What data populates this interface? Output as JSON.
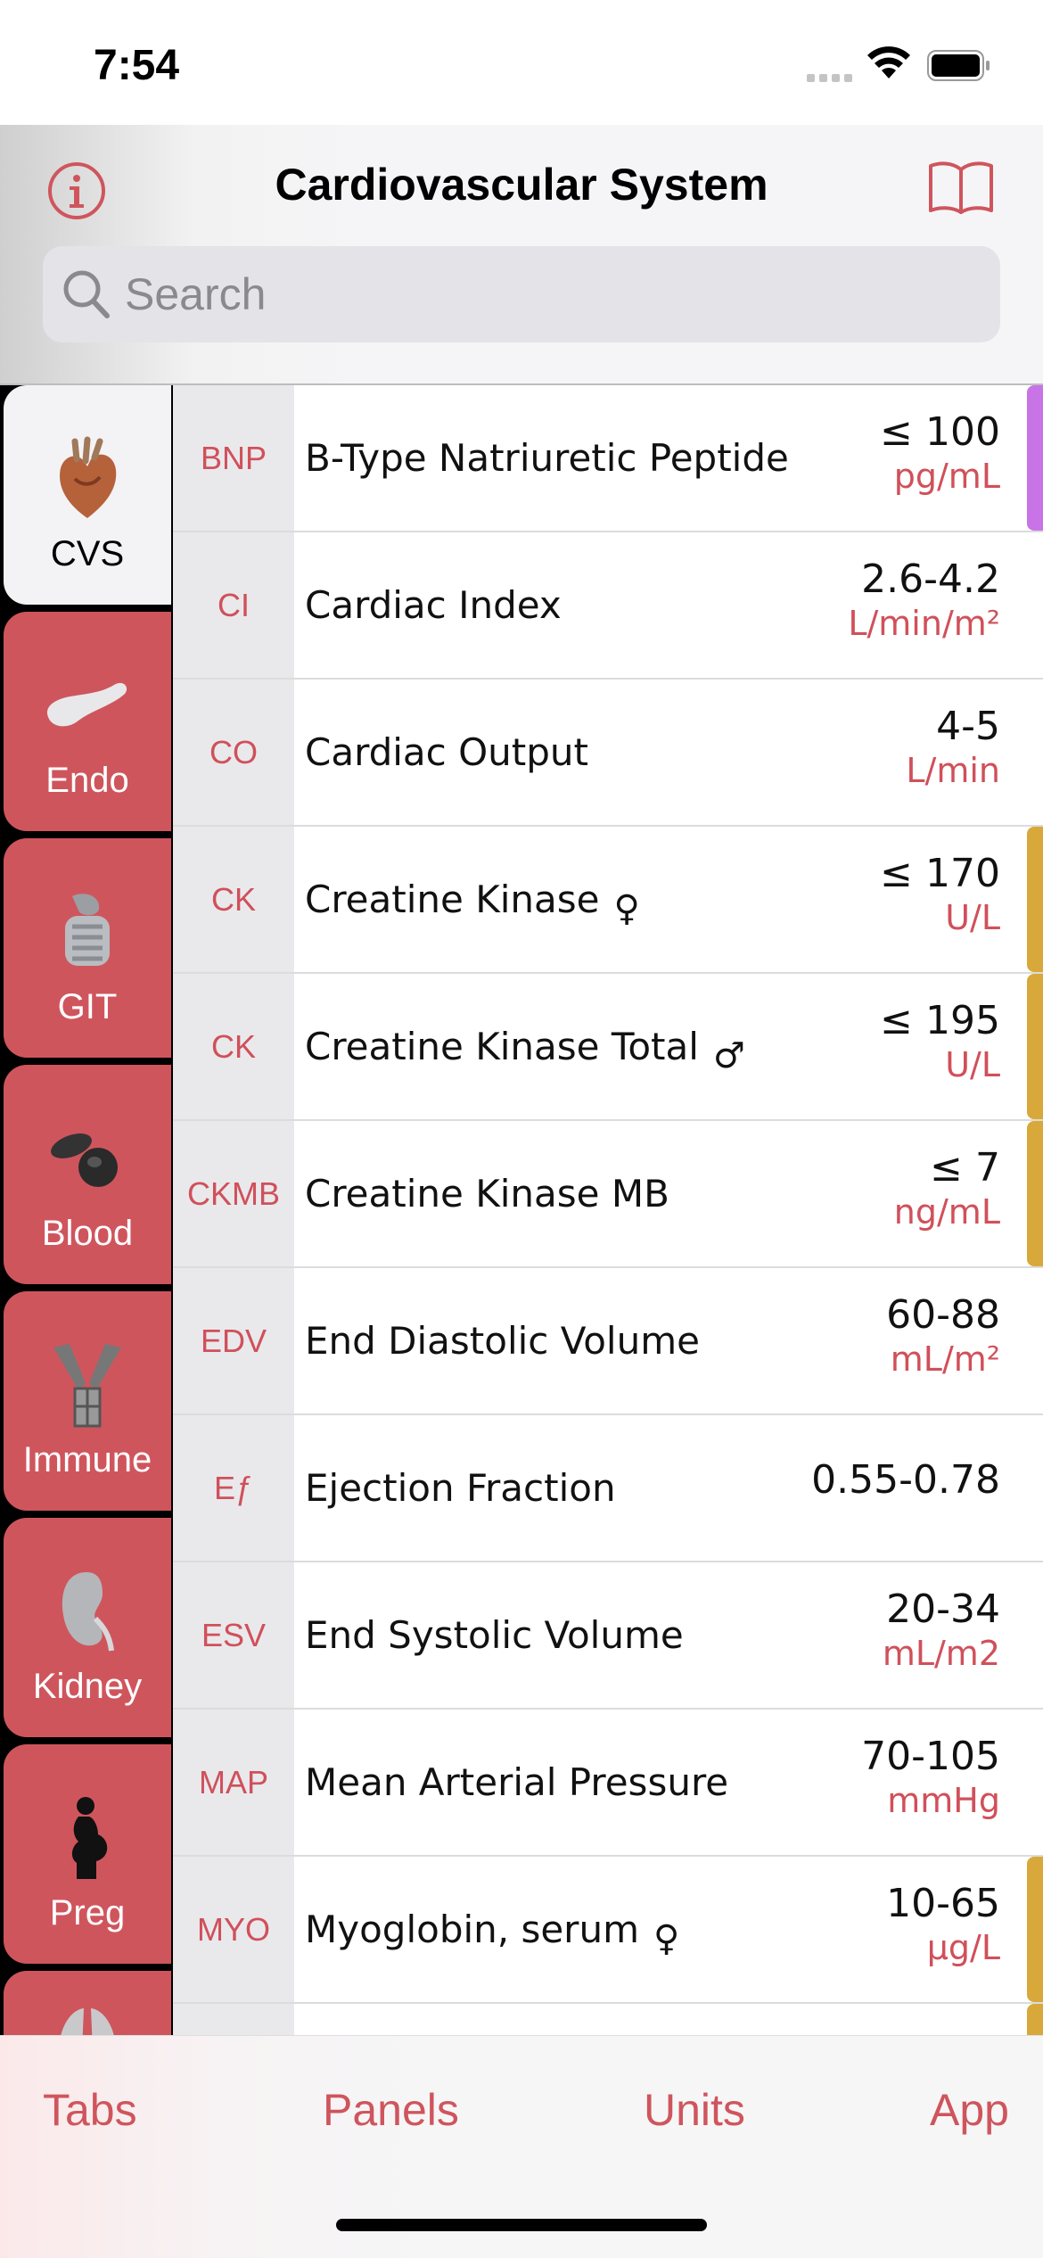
{
  "status_bar": {
    "time": "7:54"
  },
  "header": {
    "title": "Cardiovascular System",
    "search_placeholder": "Search"
  },
  "sidebar": {
    "tabs": [
      {
        "label": "CVS",
        "icon": "heart-icon",
        "active": true
      },
      {
        "label": "Endo",
        "icon": "pancreas-icon",
        "active": false
      },
      {
        "label": "GIT",
        "icon": "intestine-icon",
        "active": false
      },
      {
        "label": "Blood",
        "icon": "blood-cell-icon",
        "active": false
      },
      {
        "label": "Immune",
        "icon": "antibody-icon",
        "active": false
      },
      {
        "label": "Kidney",
        "icon": "kidney-icon",
        "active": false
      },
      {
        "label": "Preg",
        "icon": "pregnant-icon",
        "active": false
      },
      {
        "label": "",
        "icon": "lungs-icon",
        "active": false
      }
    ]
  },
  "rows": [
    {
      "abbr": "BNP",
      "name": "B-Type Natriuretic Peptide",
      "sex": "",
      "value": "≤ 100",
      "unit": "pg/mL",
      "marker": "#c874e6"
    },
    {
      "abbr": "CI",
      "name": "Cardiac Index",
      "sex": "",
      "value": "2.6-4.2",
      "unit": "L/min/m²",
      "marker": ""
    },
    {
      "abbr": "CO",
      "name": "Cardiac Output",
      "sex": "",
      "value": "4-5",
      "unit": "L/min",
      "marker": ""
    },
    {
      "abbr": "CK",
      "name": "Creatine Kinase",
      "sex": "♀",
      "value": "≤ 170",
      "unit": "U/L",
      "marker": "#d8a93a"
    },
    {
      "abbr": "CK",
      "name": "Creatine Kinase Total",
      "sex": "♂",
      "value": "≤ 195",
      "unit": "U/L",
      "marker": "#d8a93a"
    },
    {
      "abbr": "CKMB",
      "name": "Creatine Kinase MB",
      "sex": "",
      "value": "≤ 7",
      "unit": "ng/mL",
      "marker": "#d8a93a"
    },
    {
      "abbr": "EDV",
      "name": "End Diastolic Volume",
      "sex": "",
      "value": "60-88",
      "unit": "mL/m²",
      "marker": ""
    },
    {
      "abbr": "Eƒ",
      "name": "Ejection Fraction",
      "sex": "",
      "value": "0.55-0.78",
      "unit": "",
      "marker": ""
    },
    {
      "abbr": "ESV",
      "name": "End Systolic Volume",
      "sex": "",
      "value": "20-34",
      "unit": "mL/m2",
      "marker": ""
    },
    {
      "abbr": "MAP",
      "name": "Mean Arterial Pressure",
      "sex": "",
      "value": "70-105",
      "unit": "mmHg",
      "marker": ""
    },
    {
      "abbr": "MYO",
      "name": "Myoglobin, serum",
      "sex": "♀",
      "value": "10-65",
      "unit": "µg/L",
      "marker": "#d8a93a"
    },
    {
      "abbr": "",
      "name": "",
      "sex": "",
      "value": "",
      "unit": "",
      "marker": "#d8a93a"
    }
  ],
  "tabbar": {
    "tabs": "Tabs",
    "panels": "Panels",
    "units": "Units",
    "app": "App"
  },
  "colors": {
    "accent": "#cf555d",
    "purple_marker": "#c874e6",
    "gold_marker": "#d8a93a"
  }
}
